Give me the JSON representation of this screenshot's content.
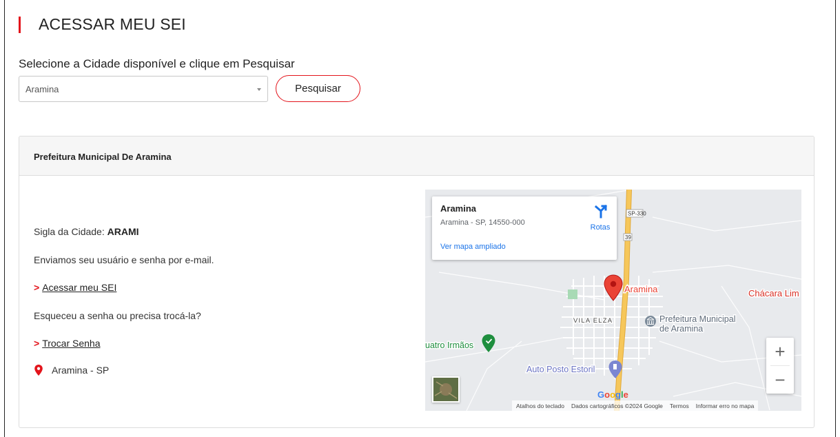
{
  "header": {
    "title": "ACESSAR MEU SEI"
  },
  "search": {
    "prompt": "Selecione a Cidade disponível e clique em Pesquisar",
    "selected_city": "Aramina",
    "button_label": "Pesquisar"
  },
  "card": {
    "title": "Prefeitura Municipal De Aramina",
    "sigla_label": "Sigla da Cidade:",
    "sigla_value": "ARAMI",
    "email_note": "Enviamos seu usuário e senha por e-mail.",
    "access_link_chevron": ">",
    "access_link": "Acessar meu SEI",
    "forgot_question": "Esqueceu a senha ou precisa trocá-la?",
    "change_link_chevron": ">",
    "change_link": "Trocar Senha",
    "location": "Aramina - SP",
    "location_icon": "map-pin-icon"
  },
  "map": {
    "info_title": "Aramina",
    "info_address": "Aramina - SP, 14550-000",
    "directions_label": "Rotas",
    "larger_map_link": "Ver mapa ampliado",
    "road_shield_1": "SP-330",
    "road_shield_2": "39",
    "place_aramina": "Aramina",
    "place_chacara": "Chácara Lim",
    "place_vila_elza": "VILA ELZA",
    "place_prefeitura_1": "Prefeitura Municipal",
    "place_prefeitura_2": "de Aramina",
    "place_quatro_irmaos": "uatro Irmãos",
    "place_auto_posto": "Auto Posto Estoril",
    "google_logo": "Google",
    "zoom_in": "+",
    "zoom_out": "−",
    "footer_shortcuts": "Atalhos do teclado",
    "footer_data": "Dados cartográficos ©2024 Google",
    "footer_terms": "Termos",
    "footer_report": "Informar erro no mapa"
  },
  "colors": {
    "accent": "#e3141b",
    "link_blue": "#1a73e8",
    "map_pin_red": "#ea4335",
    "poi_green": "#1e8e3e",
    "road_yellow": "#f6c75b"
  }
}
